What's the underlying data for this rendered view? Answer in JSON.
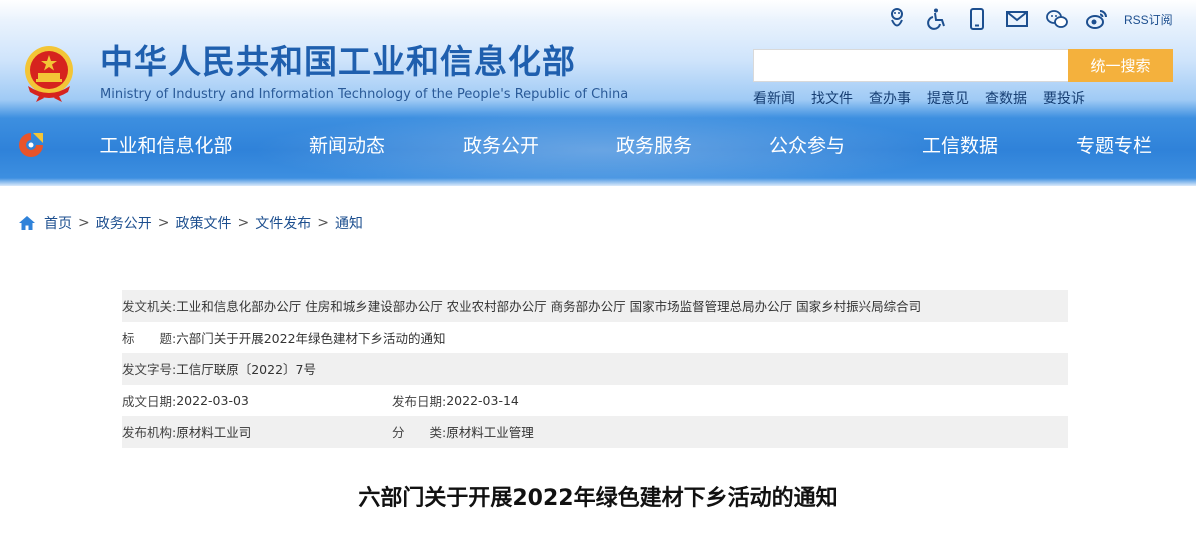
{
  "header": {
    "title_cn": "中华人民共和国工业和信息化部",
    "title_en": "Ministry of Industry and Information Technology of the People's Republic of China",
    "toolbar": {
      "icons": [
        "accessibility-care-icon",
        "wheelchair-icon",
        "mobile-phone-icon",
        "mail-icon",
        "wechat-icon",
        "weibo-icon"
      ],
      "rss_label": "RSS订阅"
    },
    "search": {
      "placeholder": "",
      "button_label": "统一搜索"
    },
    "quick_links": [
      "看新闻",
      "找文件",
      "查办事",
      "提意见",
      "查数据",
      "要投诉"
    ]
  },
  "nav": {
    "items": [
      "工业和信息化部",
      "新闻动态",
      "政务公开",
      "政务服务",
      "公众参与",
      "工信数据",
      "专题专栏"
    ]
  },
  "breadcrumb": {
    "items": [
      "首页",
      "政务公开",
      "政策文件",
      "文件发布",
      "通知"
    ],
    "separator": ">"
  },
  "meta": {
    "issuer_label": "发文机关:",
    "issuer_value": "工业和信息化部办公厅 住房和城乡建设部办公厅 农业农村部办公厅 商务部办公厅 国家市场监督管理总局办公厅 国家乡村振兴局综合司",
    "title_label": "标　　题:",
    "title_value": "六部门关于开展2022年绿色建材下乡活动的通知",
    "docno_label": "发文字号:",
    "docno_value": "工信厅联原〔2022〕7号",
    "created_label": "成文日期:",
    "created_value": "2022-03-03",
    "published_label": "发布日期:",
    "published_value": "2022-03-14",
    "org_label": "发布机构:",
    "org_value": "原材料工业司",
    "category_label": "分　　类:",
    "category_value": "原材料工业管理"
  },
  "document": {
    "title": "六部门关于开展2022年绿色建材下乡活动的通知"
  },
  "colors": {
    "brand_blue": "#1f5fae",
    "nav_blue": "#2f82d9",
    "search_button": "#f4b13d",
    "emblem_red": "#d6231e",
    "emblem_gold": "#f3c536"
  }
}
